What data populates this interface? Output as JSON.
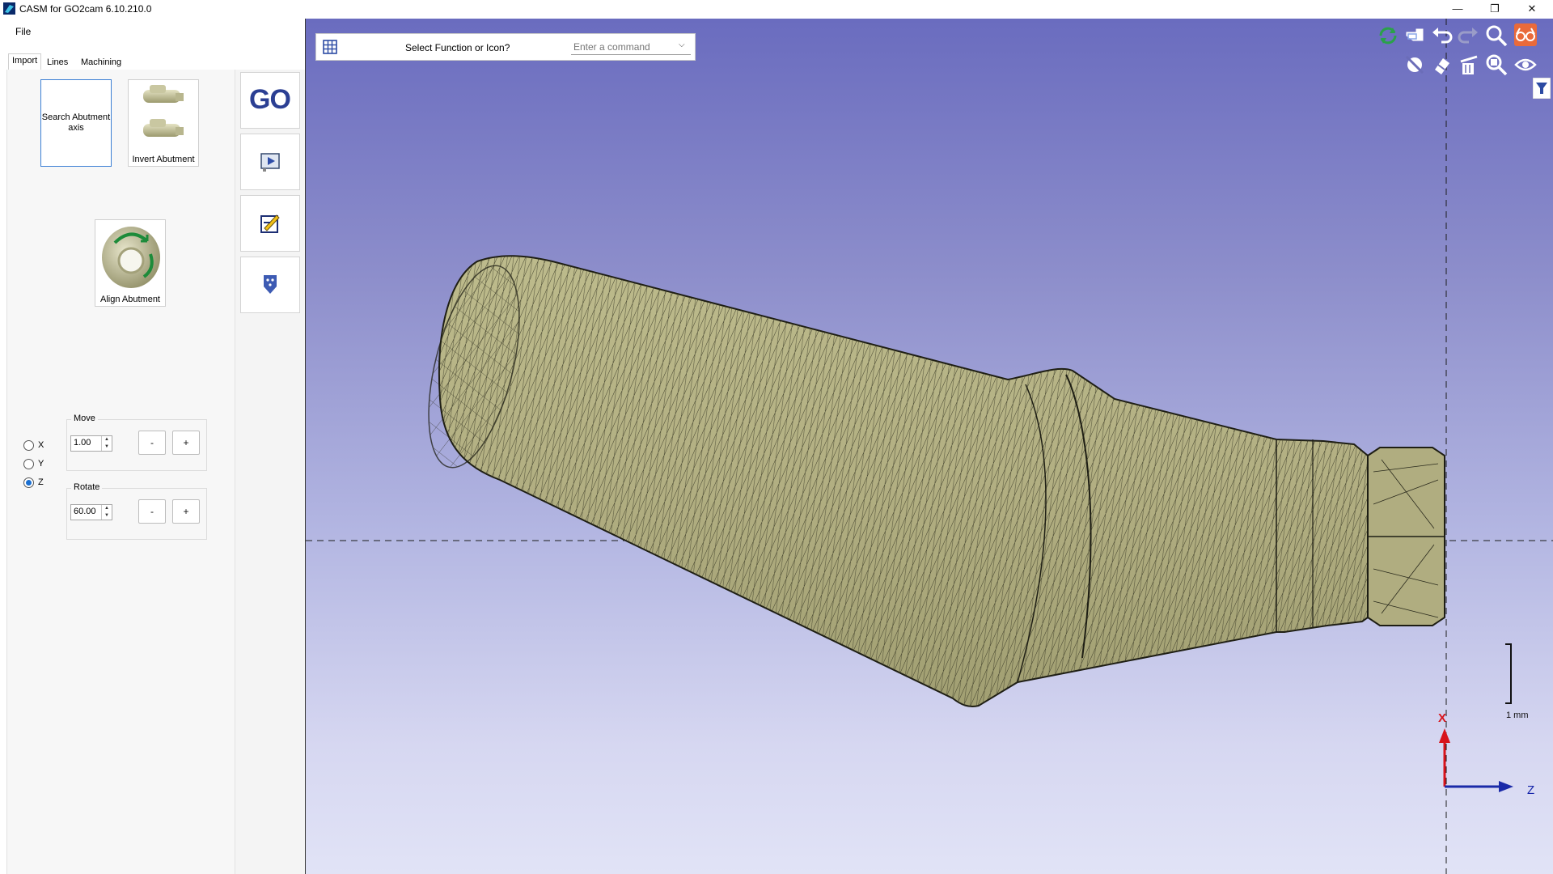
{
  "window": {
    "title": "CASM for GO2cam 6.10.210.0",
    "minimize": "—",
    "maximize": "❐",
    "close": "✕"
  },
  "menu": {
    "file": "File"
  },
  "tabs": [
    {
      "label": "Import",
      "active": true
    },
    {
      "label": "Lines",
      "active": false
    },
    {
      "label": "Machining",
      "active": false
    }
  ],
  "tools": {
    "search_axis": "Search Abutment axis",
    "invert": "Invert Abutment",
    "align": "Align Abutment"
  },
  "axes_radio": {
    "options": [
      "X",
      "Y",
      "Z"
    ],
    "selected": "Z"
  },
  "move": {
    "title": "Move",
    "value": "1.00",
    "minus": "-",
    "plus": "+"
  },
  "rotate": {
    "title": "Rotate",
    "value": "60.00",
    "minus": "-",
    "plus": "+"
  },
  "side_buttons": {
    "go": "GO"
  },
  "command_bar": {
    "label": "Select Function or Icon?",
    "placeholder": "Enter a command"
  },
  "viewport": {
    "scale_label": "1 mm",
    "axis_x": "X",
    "axis_z": "Z",
    "colors": {
      "model": "#b9b68a",
      "mesh": "#2a2a1c",
      "axis_x": "#d8141b",
      "axis_z": "#1a2aa8",
      "toolbar_green": "#2aa14a",
      "toolbar_orange": "#e96a3a"
    }
  },
  "view_toolbar": {
    "icons": [
      "refresh-icon",
      "pointer-hand-icon",
      "undo-icon",
      "redo-icon",
      "zoom-icon",
      "glasses-icon",
      "hide-icon",
      "eraser-icon",
      "clean-icon",
      "zoom-fit-icon",
      "eye-icon",
      "filter-icon"
    ]
  }
}
